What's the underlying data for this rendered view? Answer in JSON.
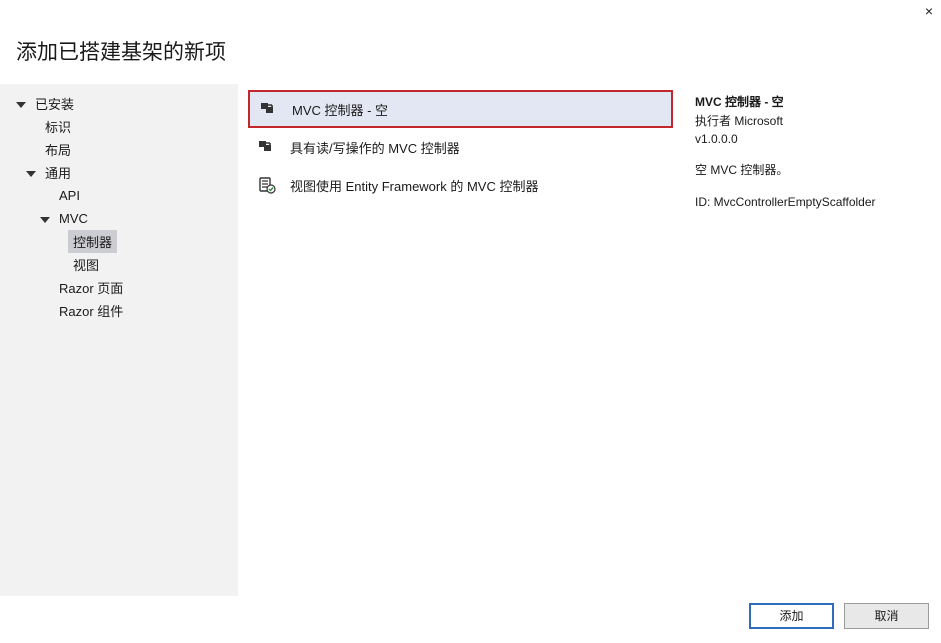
{
  "close_glyph": "×",
  "title": "添加已搭建基架的新项",
  "sidebar": {
    "items": [
      {
        "label": "已安装",
        "indent": 0,
        "expanded": true,
        "selected": false
      },
      {
        "label": "标识",
        "indent": 1,
        "expanded": false,
        "selected": false
      },
      {
        "label": "布局",
        "indent": 1,
        "expanded": false,
        "selected": false
      },
      {
        "label": "通用",
        "indent": 1,
        "expanded": true,
        "selected": false
      },
      {
        "label": "API",
        "indent": 2,
        "expanded": false,
        "selected": false
      },
      {
        "label": "MVC",
        "indent": 2,
        "expanded": true,
        "selected": false
      },
      {
        "label": "控制器",
        "indent": 3,
        "expanded": false,
        "selected": true
      },
      {
        "label": "视图",
        "indent": 3,
        "expanded": false,
        "selected": false
      },
      {
        "label": "Razor 页面",
        "indent": 2,
        "expanded": false,
        "selected": false
      },
      {
        "label": "Razor 组件",
        "indent": 2,
        "expanded": false,
        "selected": false
      }
    ]
  },
  "options": {
    "items": [
      {
        "label": "MVC 控制器 - 空",
        "icon": "controller-icon",
        "selected": true
      },
      {
        "label": "具有读/写操作的 MVC 控制器",
        "icon": "controller-icon",
        "selected": false
      },
      {
        "label": "视图使用 Entity Framework 的 MVC 控制器",
        "icon": "ef-controller-icon",
        "selected": false
      }
    ]
  },
  "details": {
    "title": "MVC 控制器 - 空",
    "author": "执行者 Microsoft",
    "version": "v1.0.0.0",
    "description": "空 MVC 控制器。",
    "id_label_value": "ID: MvcControllerEmptyScaffolder"
  },
  "footer": {
    "add_label": "添加",
    "cancel_label": "取消"
  }
}
